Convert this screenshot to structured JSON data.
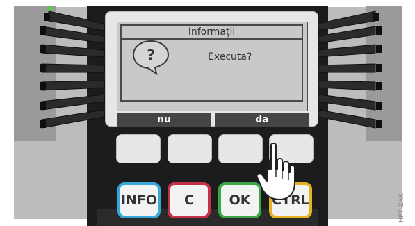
{
  "screen": {
    "title": "Informații",
    "message": "Executa?",
    "softkeys": {
      "left": "nu",
      "right": "da"
    }
  },
  "function_keys": {
    "info": "INFO",
    "c": "C",
    "ok": "OK",
    "ctrl": "CTRL"
  },
  "watermark": "HPT ZAK",
  "colors": {
    "info": "#36a7d6",
    "c": "#c8304a",
    "ok": "#3aa845",
    "ctrl": "#e6b31f",
    "body": "#1c1c1c",
    "side_panel": "#bdbdbd"
  },
  "icons": [
    "question-speech-bubble-icon",
    "pointing-hand-icon",
    "led-indicator-icon"
  ]
}
